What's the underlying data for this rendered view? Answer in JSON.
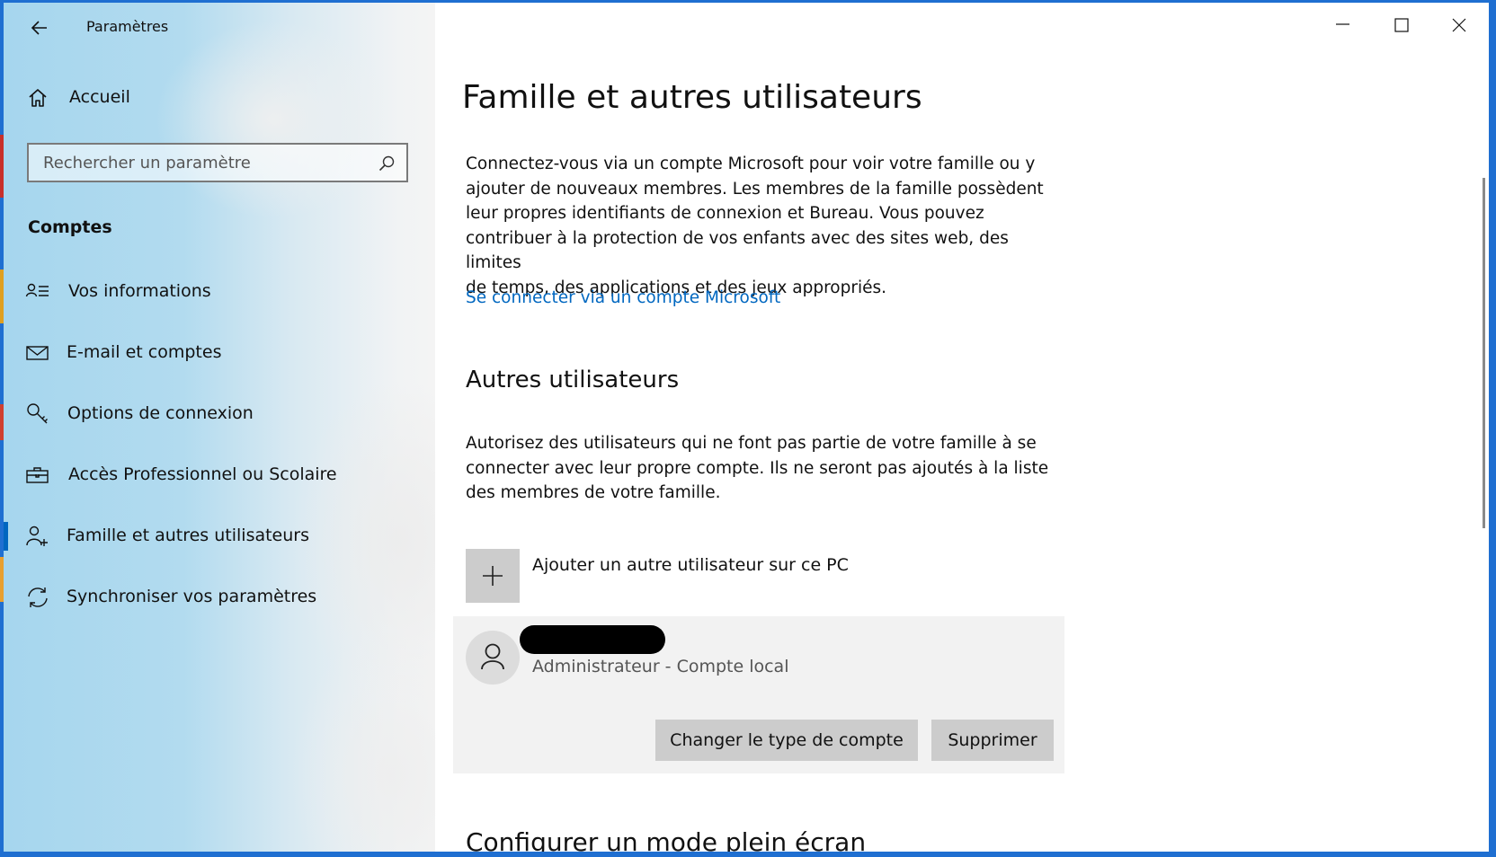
{
  "window": {
    "app_title": "Paramètres",
    "controls": [
      "minimize-icon",
      "maximize-icon",
      "close-icon"
    ]
  },
  "sidebar": {
    "home_label": "Accueil",
    "search_placeholder": "Rechercher un paramètre",
    "search_value": "",
    "section_title": "Comptes",
    "items": [
      {
        "label": "Vos informations",
        "icon": "user-info-icon",
        "selected": false
      },
      {
        "label": "E-mail et comptes",
        "icon": "mail-icon",
        "selected": false
      },
      {
        "label": "Options de connexion",
        "icon": "key-icon",
        "selected": false
      },
      {
        "label": "Accès Professionnel ou Scolaire",
        "icon": "briefcase-icon",
        "selected": false
      },
      {
        "label": "Famille et autres utilisateurs",
        "icon": "user-add-icon",
        "selected": true
      },
      {
        "label": "Synchroniser vos paramètres",
        "icon": "sync-icon",
        "selected": false
      }
    ]
  },
  "main": {
    "title": "Famille et autres utilisateurs",
    "family_para_lines": [
      "Connectez-vous via un compte Microsoft pour voir votre famille ou y",
      "ajouter de nouveaux membres. Les membres de la famille possèdent",
      "leur propres identifiants de connexion et Bureau. Vous pouvez",
      "contribuer à la protection de vos enfants avec des sites web, des limites",
      "de temps, des applications et des jeux appropriés."
    ],
    "ms_link": "Se connecter via un compte Microsoft",
    "other_users_title": "Autres utilisateurs",
    "other_para_lines": [
      "Autorisez des utilisateurs qui ne font pas partie de votre famille à se",
      "connecter avec leur propre compte. Ils ne seront pas ajoutés à la liste",
      "des membres de votre famille."
    ],
    "add_user_label": "Ajouter un autre utilisateur sur ce PC",
    "user": {
      "role": "Administrateur - Compte local",
      "change_type_label": "Changer le type de compte",
      "remove_label": "Supprimer"
    },
    "kiosk_title": "Configurer un mode plein écran"
  },
  "colors": {
    "accent": "#0067c0",
    "tile_gray": "#cccccc",
    "card_bg": "#f2f2f2"
  }
}
